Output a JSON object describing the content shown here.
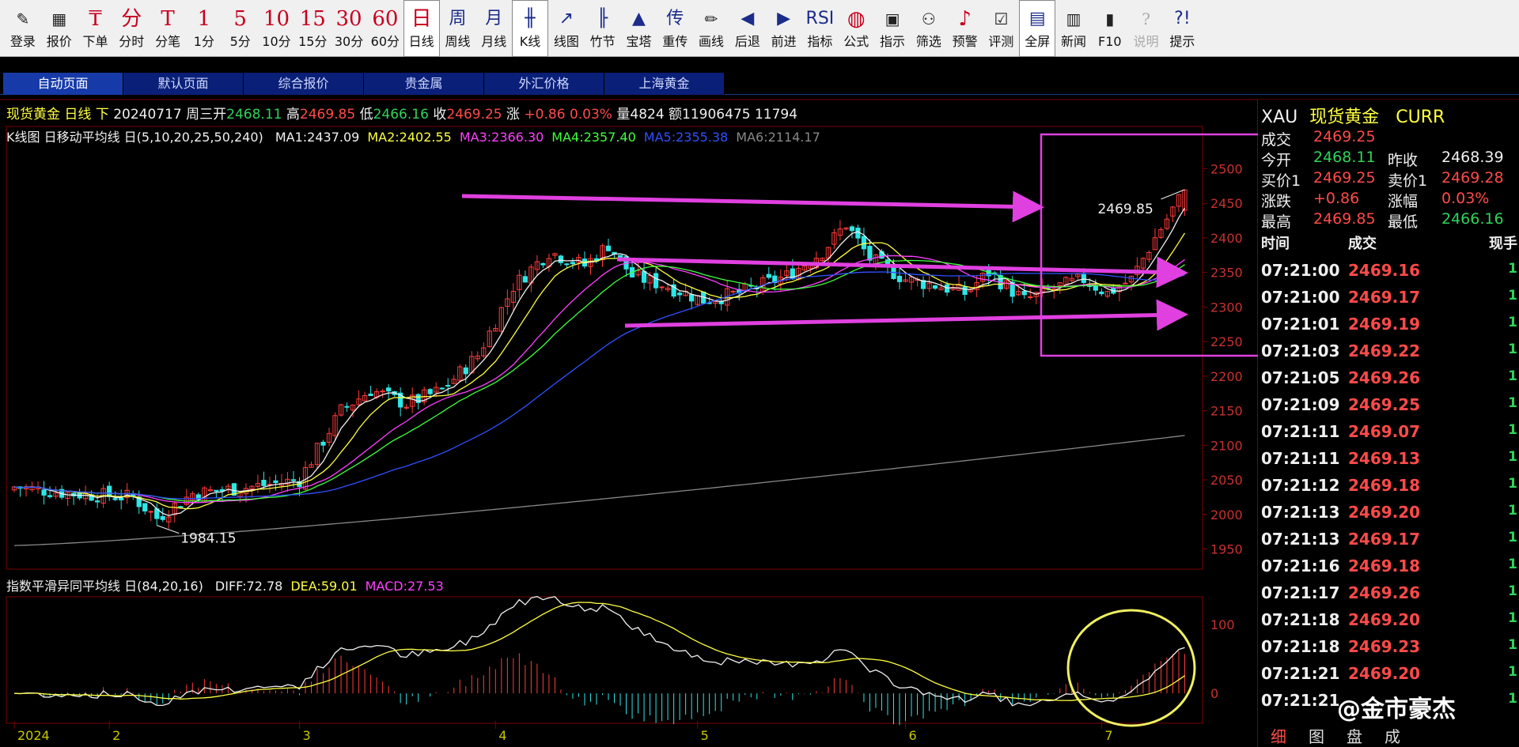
{
  "toolbar": [
    {
      "label": "登录",
      "glyph": "✎",
      "style": "dark",
      "name": "login-button"
    },
    {
      "label": "报价",
      "glyph": "▦",
      "style": "dark",
      "name": "quote-button"
    },
    {
      "label": "下单",
      "glyph": "₸",
      "style": "red",
      "name": "order-button"
    },
    {
      "label": "分时",
      "glyph": "分",
      "style": "red",
      "name": "timeshare-button"
    },
    {
      "label": "分笔",
      "glyph": "T",
      "style": "red",
      "name": "tick-button"
    },
    {
      "label": "1分",
      "glyph": "1",
      "style": "red",
      "name": "period-1m-button"
    },
    {
      "label": "5分",
      "glyph": "5",
      "style": "red",
      "name": "period-5m-button"
    },
    {
      "label": "10分",
      "glyph": "10",
      "style": "red",
      "name": "period-10m-button"
    },
    {
      "label": "15分",
      "glyph": "15",
      "style": "red",
      "name": "period-15m-button"
    },
    {
      "label": "30分",
      "glyph": "30",
      "style": "red",
      "name": "period-30m-button"
    },
    {
      "label": "60分",
      "glyph": "60",
      "style": "red",
      "name": "period-60m-button"
    },
    {
      "label": "日线",
      "glyph": "日",
      "style": "red",
      "name": "period-day-button",
      "active": true
    },
    {
      "label": "周线",
      "glyph": "周",
      "style": "blue",
      "name": "period-week-button"
    },
    {
      "label": "月线",
      "glyph": "月",
      "style": "blue",
      "name": "period-month-button"
    },
    {
      "label": "K线",
      "glyph": "╫",
      "style": "blue",
      "name": "kline-button",
      "active": true
    },
    {
      "label": "线图",
      "glyph": "↗",
      "style": "blue",
      "name": "linechart-button"
    },
    {
      "label": "竹节",
      "glyph": "╟",
      "style": "blue",
      "name": "bamboo-button"
    },
    {
      "label": "宝塔",
      "glyph": "▲",
      "style": "blue",
      "name": "tower-button"
    },
    {
      "label": "重传",
      "glyph": "传",
      "style": "blue",
      "name": "reload-button"
    },
    {
      "label": "画线",
      "glyph": "✏",
      "style": "dark",
      "name": "draw-line-button"
    },
    {
      "label": "后退",
      "glyph": "◀",
      "style": "blue",
      "name": "back-button"
    },
    {
      "label": "前进",
      "glyph": "▶",
      "style": "blue",
      "name": "forward-button"
    },
    {
      "label": "指标",
      "glyph": "RSI",
      "style": "blue",
      "name": "indicator-button"
    },
    {
      "label": "公式",
      "glyph": "◍",
      "style": "red",
      "name": "formula-button"
    },
    {
      "label": "指示",
      "glyph": "▣",
      "style": "dark",
      "name": "hint-button"
    },
    {
      "label": "筛选",
      "glyph": "⚇",
      "style": "dark",
      "name": "filter-button"
    },
    {
      "label": "预警",
      "glyph": "♪",
      "style": "red",
      "name": "alert-button"
    },
    {
      "label": "评测",
      "glyph": "☑",
      "style": "dark",
      "name": "evaluate-button"
    },
    {
      "label": "全屏",
      "glyph": "▤",
      "style": "blue",
      "name": "fullscreen-button",
      "active": true
    },
    {
      "label": "新闻",
      "glyph": "▥",
      "style": "dark",
      "name": "news-button"
    },
    {
      "label": "F10",
      "glyph": "▮",
      "style": "dark",
      "name": "f10-button"
    },
    {
      "label": "说明",
      "glyph": "?",
      "style": "dark",
      "name": "help-button",
      "disabled": true
    },
    {
      "label": "提示",
      "glyph": "?!",
      "style": "blue",
      "name": "tips-button"
    }
  ],
  "tabs": [
    "自动页面",
    "默认页面",
    "综合报价",
    "贵金属",
    "外汇价格",
    "上海黄金"
  ],
  "info": {
    "name": "现货黄金",
    "period": "日线",
    "arrow": "下",
    "date": "20240717",
    "weekday": "周三",
    "open_label": "开",
    "open": "2468.11",
    "high_label": "高",
    "high": "2469.85",
    "low_label": "低",
    "low": "2466.16",
    "close_label": "收",
    "close": "2469.25",
    "chg_label": "涨",
    "chg": "+0.86",
    "chg_pct": "0.03%",
    "vol_label": "量",
    "vol": "4824",
    "amt_label": "额",
    "amt": "11906475",
    "extra": "11794"
  },
  "ma": {
    "title": "K线图 日移动平均线 日(5,10,20,25,50,240)",
    "items": [
      {
        "text": "MA1:2437.09",
        "color": "#f0f0f0"
      },
      {
        "text": "MA2:2402.55",
        "color": "#ffff40"
      },
      {
        "text": "MA3:2366.30",
        "color": "#ff40ff"
      },
      {
        "text": "MA4:2357.40",
        "color": "#40ff40"
      },
      {
        "text": "MA5:2355.38",
        "color": "#3050ff"
      },
      {
        "text": "MA6:2114.17",
        "color": "#888888"
      }
    ]
  },
  "macd": {
    "title": "指数平滑异同平均线 日(84,20,16)",
    "items": [
      {
        "text": "DIFF:72.78",
        "color": "#f0f0f0"
      },
      {
        "text": "DEA:59.01",
        "color": "#ffff40"
      },
      {
        "text": "MACD:27.53",
        "color": "#ff40ff"
      }
    ]
  },
  "chart_data": {
    "type": "candlestick",
    "y_ticks": [
      "2500",
      "2450",
      "2400",
      "2350",
      "2300",
      "2250",
      "2200",
      "2150",
      "2100",
      "2050",
      "2000",
      "1950"
    ],
    "ylim": [
      1930,
      2520
    ],
    "macd_ticks": [
      "100",
      "0"
    ],
    "macd_ylim": [
      -40,
      140
    ],
    "x_labels": [
      {
        "text": "2024",
        "idx": 0
      },
      {
        "text": "2",
        "idx": 16
      },
      {
        "text": "3",
        "idx": 48
      },
      {
        "text": "4",
        "idx": 81
      },
      {
        "text": "5",
        "idx": 115
      },
      {
        "text": "6",
        "idx": 150
      },
      {
        "text": "7",
        "idx": 183
      }
    ],
    "annotations": [
      {
        "text": "2469.85",
        "kind": "high"
      },
      {
        "text": "1984.15",
        "kind": "low"
      }
    ],
    "candle_count": 198,
    "last_close": 2469.25,
    "low_point": 1984.15,
    "high_point": 2469.85
  },
  "quote": {
    "symbol": "XAU",
    "name": "现货黄金",
    "code": "CURR",
    "rows": [
      {
        "l1": "成交",
        "v1": "2469.25",
        "l2": "",
        "v2": "",
        "c1": "#ff4a4a",
        "c2": "#ff4a4a"
      },
      {
        "l1": "今开",
        "v1": "2468.11",
        "l2": "昨收",
        "v2": "2468.39",
        "c1": "#2fd35a",
        "c2": "#f0f0f0"
      },
      {
        "l1": "买价1",
        "v1": "2469.25",
        "l2": "卖价1",
        "v2": "2469.28",
        "c1": "#ff4a4a",
        "c2": "#ff4a4a"
      },
      {
        "l1": "涨跌",
        "v1": "+0.86",
        "l2": "涨幅",
        "v2": "0.03%",
        "c1": "#ff4a4a",
        "c2": "#ff4a4a"
      },
      {
        "l1": "最高",
        "v1": "2469.85",
        "l2": "最低",
        "v2": "2466.16",
        "c1": "#ff4a4a",
        "c2": "#2fd35a"
      }
    ],
    "tick_header": {
      "time": "时间",
      "price": "成交",
      "vol": "现手"
    },
    "ticks": [
      {
        "t": "07:21:00",
        "p": "2469.16",
        "v": "1"
      },
      {
        "t": "07:21:00",
        "p": "2469.17",
        "v": "1"
      },
      {
        "t": "07:21:01",
        "p": "2469.19",
        "v": "1"
      },
      {
        "t": "07:21:03",
        "p": "2469.22",
        "v": "1"
      },
      {
        "t": "07:21:05",
        "p": "2469.26",
        "v": "1"
      },
      {
        "t": "07:21:09",
        "p": "2469.25",
        "v": "1"
      },
      {
        "t": "07:21:11",
        "p": "2469.07",
        "v": "1"
      },
      {
        "t": "07:21:11",
        "p": "2469.13",
        "v": "1"
      },
      {
        "t": "07:21:12",
        "p": "2469.18",
        "v": "1"
      },
      {
        "t": "07:21:13",
        "p": "2469.20",
        "v": "1"
      },
      {
        "t": "07:21:13",
        "p": "2469.17",
        "v": "1"
      },
      {
        "t": "07:21:16",
        "p": "2469.18",
        "v": "1"
      },
      {
        "t": "07:21:17",
        "p": "2469.26",
        "v": "1"
      },
      {
        "t": "07:21:18",
        "p": "2469.20",
        "v": "1"
      },
      {
        "t": "07:21:18",
        "p": "2469.23",
        "v": "1"
      },
      {
        "t": "07:21:21",
        "p": "2469.20",
        "v": "1"
      },
      {
        "t": "07:21:21",
        "p": "",
        "v": "1"
      }
    ],
    "bottom_tabs": [
      "细",
      "图",
      "盘",
      "成"
    ]
  },
  "watermark": "@金市豪杰",
  "colors": {
    "up": "#ff3b3b",
    "down": "#2ee6e6",
    "grid": "#7a0000",
    "annot": "#e040e0",
    "circle": "#f0f060"
  }
}
